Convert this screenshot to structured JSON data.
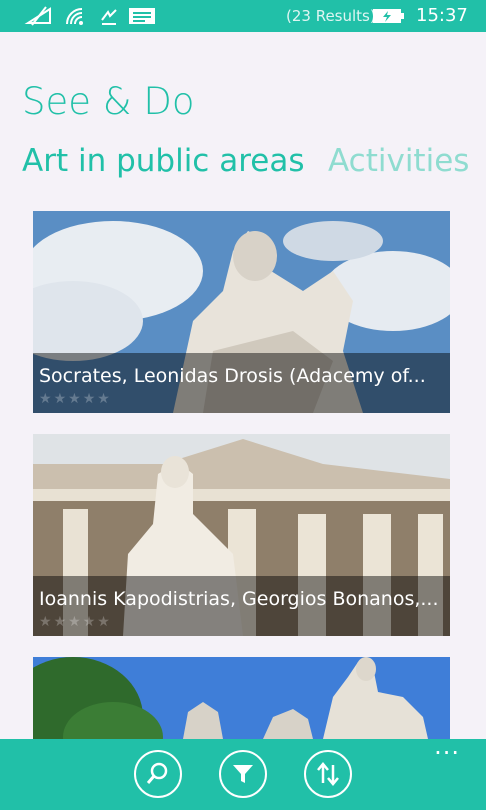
{
  "status": {
    "results": "(23 Results)",
    "time": "15:37"
  },
  "title": "See & Do",
  "tabs": [
    {
      "label": "Art in public areas"
    },
    {
      "label": "Activities"
    }
  ],
  "cards": [
    {
      "caption": "Socrates, Leonidas Drosis (Adacemy of..."
    },
    {
      "caption": "Ioannis Kapodistrias, Georgios Bonanos,..."
    },
    {
      "caption": ""
    }
  ],
  "appbar": {
    "more": "···"
  },
  "colors": {
    "accent": "#21c0a8",
    "background": "#f5f2f8"
  }
}
